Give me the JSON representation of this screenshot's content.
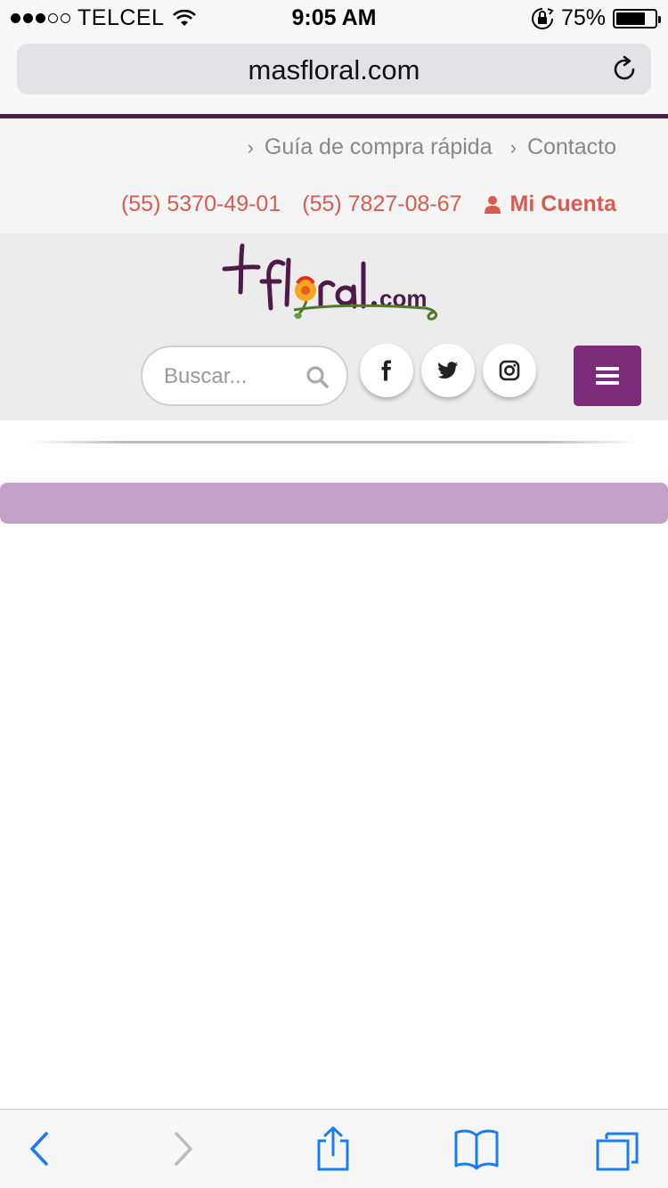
{
  "status_bar": {
    "carrier": "TELCEL",
    "signal_bars": 3,
    "signal_total": 5,
    "time": "9:05 AM",
    "battery_percent": "75%",
    "battery_level": 0.75
  },
  "browser": {
    "url": "masfloral.com"
  },
  "top_links": {
    "guide": "Guía de compra rápida",
    "contact": "Contacto"
  },
  "contact": {
    "phone1": "(55) 5370-49-01",
    "phone2": "(55) 7827-08-67",
    "account": "Mi Cuenta"
  },
  "logo": {
    "alt_text": "+floral.com"
  },
  "search": {
    "placeholder": "Buscar..."
  },
  "social": [
    "facebook-icon",
    "twitter-icon",
    "instagram-icon"
  ],
  "colors": {
    "brand_purple": "#7b2b78",
    "header_rule": "#4a1f48",
    "contact_red": "#d95b4f",
    "banner_lilac": "#c4a1c9",
    "ios_blue": "#1a7cf5"
  }
}
